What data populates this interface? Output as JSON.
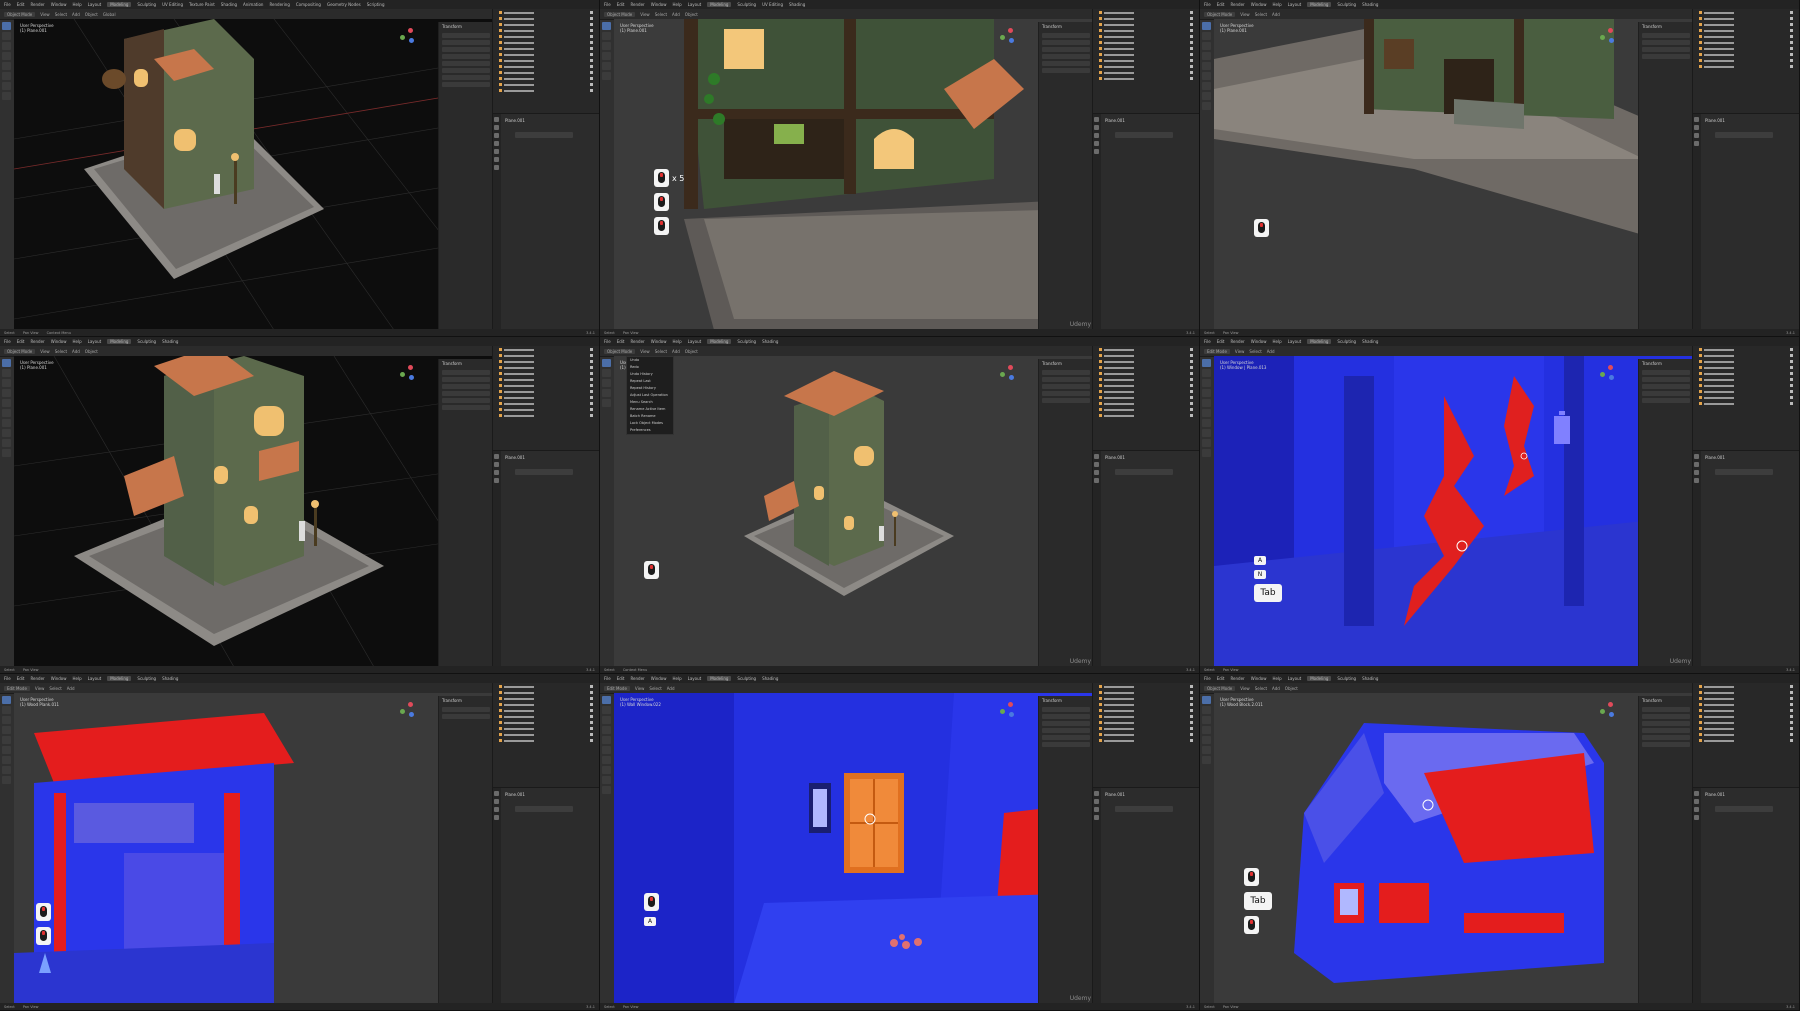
{
  "app": {
    "menu": [
      "File",
      "Edit",
      "Render",
      "Window",
      "Help"
    ],
    "workspaces": [
      "Layout",
      "Modeling",
      "Sculpting",
      "UV Editing",
      "Texture Paint",
      "Shading",
      "Animation",
      "Rendering",
      "Compositing",
      "Geometry Nodes",
      "Scripting"
    ],
    "active_workspace": "Modeling",
    "scene": "Scene",
    "view_layer": "ViewLayer",
    "watermark": "Udemy"
  },
  "panels": [
    {
      "mode": "Object Mode",
      "view": "User Perspective",
      "object": "(1) Plane.001",
      "keys": [],
      "menu": false
    },
    {
      "mode": "Object Mode",
      "view": "User Perspective",
      "object": "(1) Plane.001",
      "keys": [
        {
          "type": "mouse",
          "count": "x 5"
        },
        {
          "type": "mouse"
        },
        {
          "type": "mouse"
        }
      ],
      "menu": false
    },
    {
      "mode": "Object Mode",
      "view": "User Perspective",
      "object": "(1) Plane.001",
      "keys": [
        {
          "type": "mouse"
        }
      ],
      "menu": false
    },
    {
      "mode": "Object Mode",
      "view": "User Perspective",
      "object": "(1) Plane.001",
      "keys": [],
      "menu": false
    },
    {
      "mode": "Object Mode",
      "view": "User Perspective",
      "object": "(1) Plane.001",
      "keys": [
        {
          "type": "mouse"
        }
      ],
      "menu": true
    },
    {
      "mode": "Edit Mode",
      "view": "User Perspective",
      "object": "(1) Window | Plane.013",
      "keys": [
        {
          "type": "small",
          "label": "A"
        },
        {
          "type": "small",
          "label": "N"
        },
        {
          "type": "key",
          "label": "Tab"
        }
      ],
      "menu": false
    },
    {
      "mode": "Edit Mode",
      "view": "User Perspective",
      "object": "(1) Wood Plank.011",
      "keys": [
        {
          "type": "mouse"
        },
        {
          "type": "mouse"
        }
      ],
      "menu": false
    },
    {
      "mode": "Edit Mode",
      "view": "User Perspective",
      "object": "(1) Wall Window.022",
      "keys": [
        {
          "type": "mouse"
        },
        {
          "type": "small",
          "label": "A"
        }
      ],
      "menu": false
    },
    {
      "mode": "Object Mode",
      "view": "User Perspective",
      "object": "(1) Wood Block.2.011",
      "keys": [
        {
          "type": "mouse"
        },
        {
          "type": "key",
          "label": "Tab"
        },
        {
          "type": "mouse"
        }
      ],
      "menu": false
    }
  ],
  "header": {
    "view": "View",
    "select": "Select",
    "add": "Add",
    "object": "Object",
    "global": "Global",
    "options": "Options"
  },
  "npanel": {
    "transform": "Transform",
    "location": "Location",
    "rotation": "Rotation",
    "scale": "Scale",
    "dimensions": "Dimensions",
    "properties": "Properties"
  },
  "outliner_items": [
    "Cube",
    "Cube.001",
    "Cube.002",
    "Cube.003",
    "Cube.004",
    "Cube.005",
    "Cube.006",
    "Cube.007",
    "Cylinder",
    "Cylinder.001",
    "Cylinder.002",
    "Plane.001",
    "Plane.002",
    "Plane.003",
    "Wood Block",
    "Wood Block.001",
    "Wood Block.002"
  ],
  "props_title": "Plane.001",
  "add_modifier": "Add Modifier",
  "menu_items": [
    "Undo",
    "Redo",
    "Undo History",
    "Repeat Last",
    "Repeat History",
    "Adjust Last Operation",
    "Menu Search",
    "Rename Active Item",
    "Batch Rename",
    "Lock Object Modes",
    "Preferences"
  ],
  "statusbar": {
    "select": "Select",
    "pan": "Pan View",
    "menu": "Context Menu",
    "version": "3.4.1"
  }
}
